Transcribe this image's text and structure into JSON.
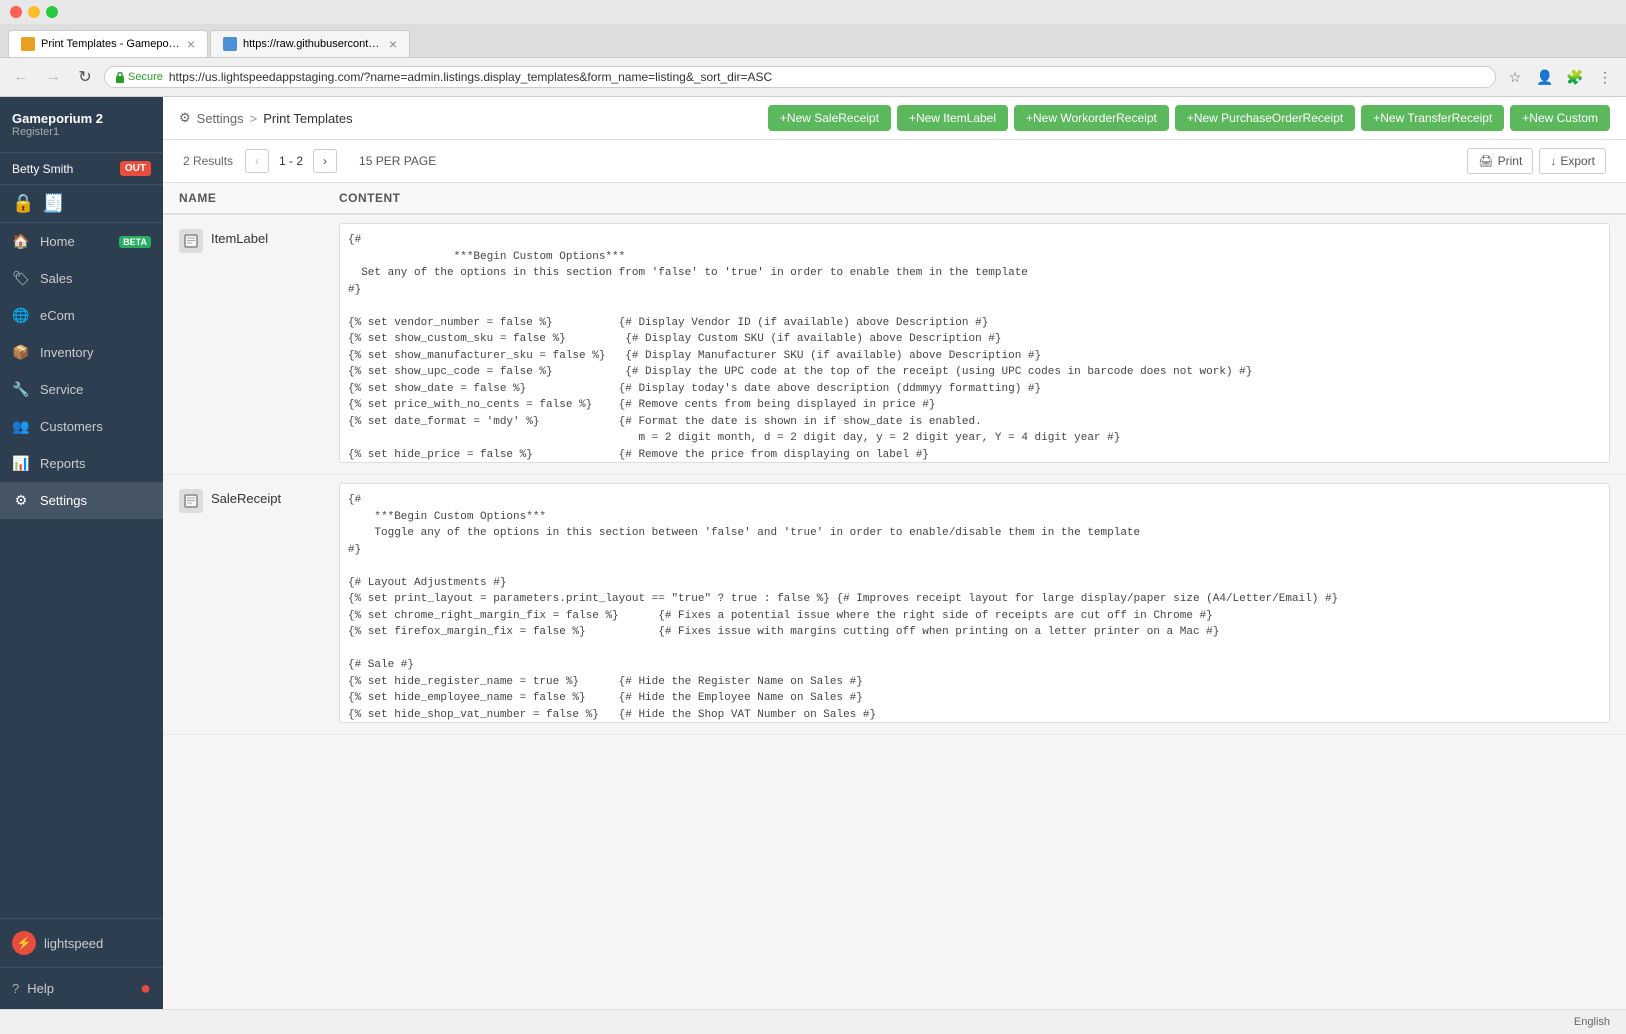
{
  "browser": {
    "tabs": [
      {
        "id": "tab1",
        "title": "Print Templates - Gameporium",
        "favicon_color": "#e8a020",
        "active": true
      },
      {
        "id": "tab2",
        "title": "https://raw.githubusercontent...",
        "favicon_color": "#4a90d9",
        "active": false
      }
    ],
    "address": "https://us.lightspeedappstaging.com/?name=admin.listings.display_templates&form_name=listing&_sort_dir=ASC",
    "secure_label": "Secure"
  },
  "sidebar": {
    "company": "Gameporium 2",
    "register": "Register1",
    "user": "Betty Smith",
    "out_label": "OUT",
    "items": [
      {
        "id": "lock",
        "label": "Lock",
        "icon": "🔒"
      },
      {
        "id": "home",
        "label": "Home",
        "icon": "🏠",
        "badge": "BETA"
      },
      {
        "id": "sales",
        "label": "Sales",
        "icon": "🏷"
      },
      {
        "id": "ecom",
        "label": "eCom",
        "icon": "🌐"
      },
      {
        "id": "inventory",
        "label": "Inventory",
        "icon": "📦"
      },
      {
        "id": "service",
        "label": "Service",
        "icon": "🔧"
      },
      {
        "id": "customers",
        "label": "Customers",
        "icon": "👥"
      },
      {
        "id": "reports",
        "label": "Reports",
        "icon": "📊"
      },
      {
        "id": "settings",
        "label": "Settings",
        "icon": "⚙",
        "active": true
      }
    ],
    "logo_text": "lightspeed",
    "help_label": "Help"
  },
  "header": {
    "settings_label": "Settings",
    "breadcrumb_sep": ">",
    "page_title": "Print Templates"
  },
  "action_buttons": [
    {
      "id": "new-sale",
      "label": "+New SaleReceipt"
    },
    {
      "id": "new-item",
      "label": "+New ItemLabel"
    },
    {
      "id": "new-workorder",
      "label": "+New WorkorderReceipt"
    },
    {
      "id": "new-purchase",
      "label": "+New PurchaseOrderReceipt"
    },
    {
      "id": "new-transfer",
      "label": "+New TransferReceipt"
    },
    {
      "id": "new-custom",
      "label": "+New Custom"
    }
  ],
  "table_controls": {
    "results": "2 Results",
    "pagination": "1 - 2",
    "per_page": "15 PER PAGE",
    "print_label": "Print",
    "export_label": "Export"
  },
  "columns": {
    "name": "NAME",
    "content": "CONTENT"
  },
  "templates": [
    {
      "id": "item-label",
      "name": "ItemLabel",
      "content": "{#\n                ***Begin Custom Options***\n  Set any of the options in this section from 'false' to 'true' in order to enable them in the template\n#}\n\n{% set vendor_number = false %}          {# Display Vendor ID (if available) above Description #}\n{% set show_custom_sku = false %}         {# Display Custom SKU (if available) above Description #}\n{% set show_manufacturer_sku = false %}   {# Display Manufacturer SKU (if available) above Description #}\n{% set show_upc_code = false %}           {# Display the UPC code at the top of the receipt (using UPC codes in barcode does not work) #}\n{% set show_date = false %}              {# Display today's date above description (ddmmyy formatting) #}\n{% set price_with_no_cents = false %}    {# Remove cents from being displayed in price #}\n{% set date_format = 'mdy' %}            {# Format the date is shown in if show_date is enabled.\n                                            m = 2 digit month, d = 2 digit day, y = 2 digit year, Y = 4 digit year #}\n{% set hide_price = false %}             {# Remove the price from displaying on label #}\n{% set hide_description = false %}       {# Remove the description from displaying on label #}\n{% set hide_barcode = false %}           {# Remove the barcode from displaying on label #}\n{% set hide_barcode_sku = false %}       {# Remove the System ID from displaying at the bottom of barcdoes\n#}"
    },
    {
      "id": "sale-receipt",
      "name": "SaleReceipt",
      "content": "{#\n    ***Begin Custom Options***\n    Toggle any of the options in this section between 'false' and 'true' in order to enable/disable them in the template\n#}\n\n{# Layout Adjustments #}\n{% set print_layout = parameters.print_layout == \"true\" ? true : false %} {# Improves receipt layout for large display/paper size (A4/Letter/Email) #}\n{% set chrome_right_margin_fix = false %}      {# Fixes a potential issue where the right side of receipts are cut off in Chrome #}\n{% set firefox_margin_fix = false %}           {# Fixes issue with margins cutting off when printing on a letter printer on a Mac #}\n\n{# Sale #}\n{% set hide_register_name = true %}      {# Hide the Register Name on Sales #}\n{% set hide_employee_name = false %}     {# Hide the Employee Name on Sales #}\n{% set hide_shop_vat_number = false %}   {# Hide the Shop VAT Number on Sales #}\n{% set hide_shop_registration_number = false %}   {# Hide the Shop Registration Number on Sales #}\n{% set hide_customer_vat_number = false %}   {# Hide the Customer VAT Number on Sales #}"
    }
  ],
  "footer": {
    "language": "English"
  }
}
